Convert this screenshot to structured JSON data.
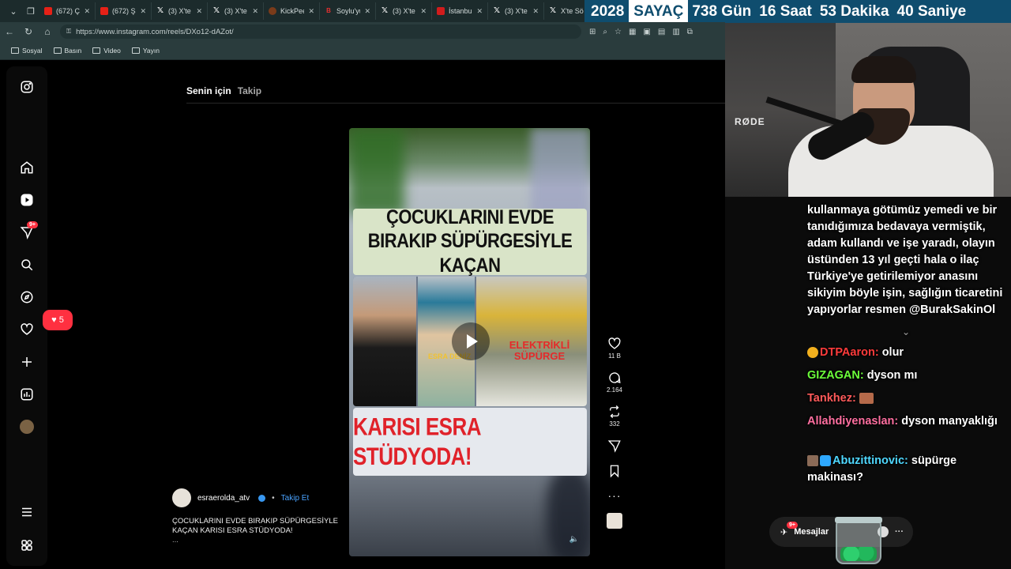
{
  "browser": {
    "tabs": [
      {
        "label": "(672) Çalı",
        "icon": "youtube-icon",
        "fav": "yt"
      },
      {
        "label": "(672) Şarı",
        "icon": "youtube-icon",
        "fav": "yt"
      },
      {
        "label": "(3) X'te",
        "icon": "x-icon",
        "fav": "xx"
      },
      {
        "label": "(3) X'te O",
        "icon": "x-icon",
        "fav": "xx"
      },
      {
        "label": "KickPeek",
        "icon": "kickpeek-icon",
        "fav": "kp"
      },
      {
        "label": "Soylu'yu",
        "icon": "b-icon",
        "fav": "b"
      },
      {
        "label": "(3) X'te İ",
        "icon": "x-icon",
        "fav": "xx"
      },
      {
        "label": "İstanbul'",
        "icon": "istanbul-icon",
        "fav": "ist"
      },
      {
        "label": "(3) X'te A",
        "icon": "x-icon",
        "fav": "xx"
      },
      {
        "label": "X'te Sö",
        "icon": "x-icon",
        "fav": "xx"
      }
    ],
    "url": "https://www.instagram.com/reels/DXo12-dAZot/",
    "bookmarks": [
      "Sosyal",
      "Basın",
      "Video",
      "Yayın"
    ]
  },
  "counter": {
    "year": "2028",
    "label": "SAYAÇ",
    "days": "738 Gün",
    "hours": "16 Saat",
    "minutes": "53 Dakika",
    "seconds": "40 Saniye"
  },
  "instagram": {
    "feed_tabs": {
      "for_you": "Senin için",
      "following": "Takip"
    },
    "sidebar_badges": {
      "messages": "9+",
      "notifications": "5"
    },
    "reel": {
      "headline": "ÇOCUKLARINI EVDE BIRAKIP SÜPÜRGESİYLE KAÇAN",
      "name_overlay": "ESRA DENİZ",
      "red_overlay": "ELEKTRİKLİ SÜPÜRGE",
      "bottom_banner": "KARISI ESRA STÜDYODA!"
    },
    "actions": {
      "likes": "11 B",
      "comments": "2.164",
      "reposts": "332"
    },
    "author": {
      "username": "esraerolda_atv",
      "follow": "Takip Et"
    },
    "caption": "ÇOCUKLARINI EVDE BIRAKIP SÜPÜRGESİYLE KAÇAN KARISI ESRA STÜDYODA!",
    "caption_more": "..."
  },
  "webcam": {
    "mic_brand": "RØDE"
  },
  "chat": {
    "long_message": "kullanmaya götümüz yemedi ve bir tanıdığımıza bedavaya vermiştik, adam kullandı ve işe yaradı, olayın üstünden 13 yıl geçti hala o ilaç Türkiye'ye getirilemiyor anasını sikiyim böyle işin, sağlığın ticaretini yapıyorlar resmen @BurakSakinOl",
    "messages": [
      {
        "user": "DTPAaron:",
        "text": "olur",
        "color": "#ff3b3b"
      },
      {
        "user": "GIZAGAN:",
        "text": "dyson mı",
        "color": "#6cff3a"
      },
      {
        "user": "Tankhez:",
        "text": "",
        "color": "#ff5a5a"
      },
      {
        "user": "Allahdiyenaslan:",
        "text": "dyson manyaklığı",
        "color": "#ff6fa0"
      },
      {
        "user": "Abuzittinovic:",
        "text": "süpürge makinası?",
        "color": "#4fd8ff"
      }
    ]
  },
  "messages_bar": {
    "label": "Mesajlar",
    "badge": "9+"
  }
}
